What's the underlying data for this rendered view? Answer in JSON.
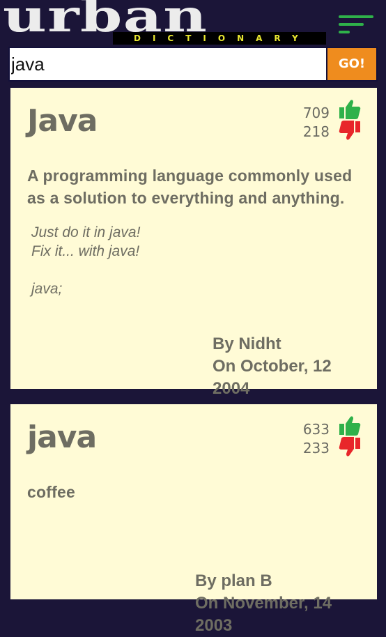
{
  "header": {
    "logo_word": "urban",
    "logo_sub": "DICTIONARY",
    "menu_icon": "hamburger-menu-icon"
  },
  "search": {
    "value": "java",
    "go_label": "GO!"
  },
  "colors": {
    "background": "#1b1538",
    "card": "#fffbd6",
    "accent": "#ef8c1e",
    "thumb_up": "#2fb14a",
    "thumb_down": "#e8262a"
  },
  "definitions": [
    {
      "word": "Java",
      "up_votes": "709",
      "down_votes": "218",
      "meaning": "A programming language commonly used as a solution to everything and anything.",
      "example": "Just do it in java!\nFix it... with java!\n\njava;",
      "author": "By Nidht",
      "date": "On October, 12 2004"
    },
    {
      "word": "java",
      "up_votes": "633",
      "down_votes": "233",
      "meaning": "coffee",
      "example": "",
      "author": "By plan B",
      "date": "On November, 14 2003"
    }
  ]
}
